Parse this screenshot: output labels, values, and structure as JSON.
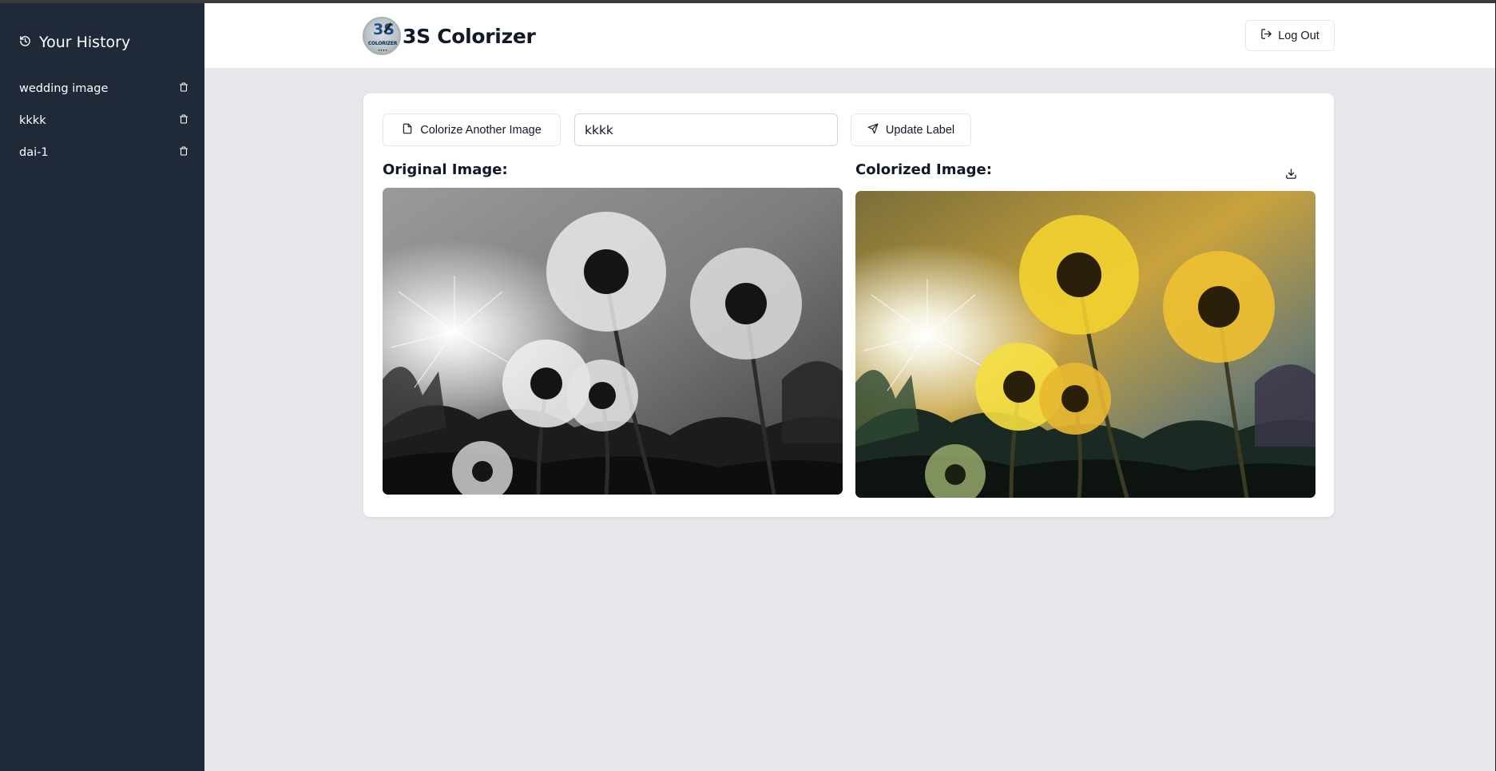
{
  "sidebar": {
    "title": "Your History",
    "title_icon": "history-icon",
    "items": [
      {
        "label": "wedding image",
        "icon": "trash-icon"
      },
      {
        "label": "kkkk",
        "icon": "trash-icon"
      },
      {
        "label": "dai-1",
        "icon": "trash-icon"
      }
    ]
  },
  "header": {
    "brand": "3S Colorizer",
    "logo": {
      "mark": "3S",
      "text": "COLORIZER",
      "subtext": "ಕ ಕ ಕ ಕ"
    },
    "logout_label": "Log Out",
    "logout_icon": "log-out-icon"
  },
  "toolbar": {
    "colorize_label": "Colorize Another Image",
    "colorize_icon": "file-icon",
    "label_input_value": "kkkk",
    "update_label": "Update Label",
    "update_icon": "send-icon"
  },
  "images": {
    "original_title": "Original Image:",
    "colorized_title": "Colorized Image:",
    "download_icon": "download-icon"
  },
  "colors": {
    "sidebar_bg": "#1f2937",
    "page_bg": "#e5e7eb",
    "card_bg": "#ffffff",
    "text": "#111827"
  }
}
